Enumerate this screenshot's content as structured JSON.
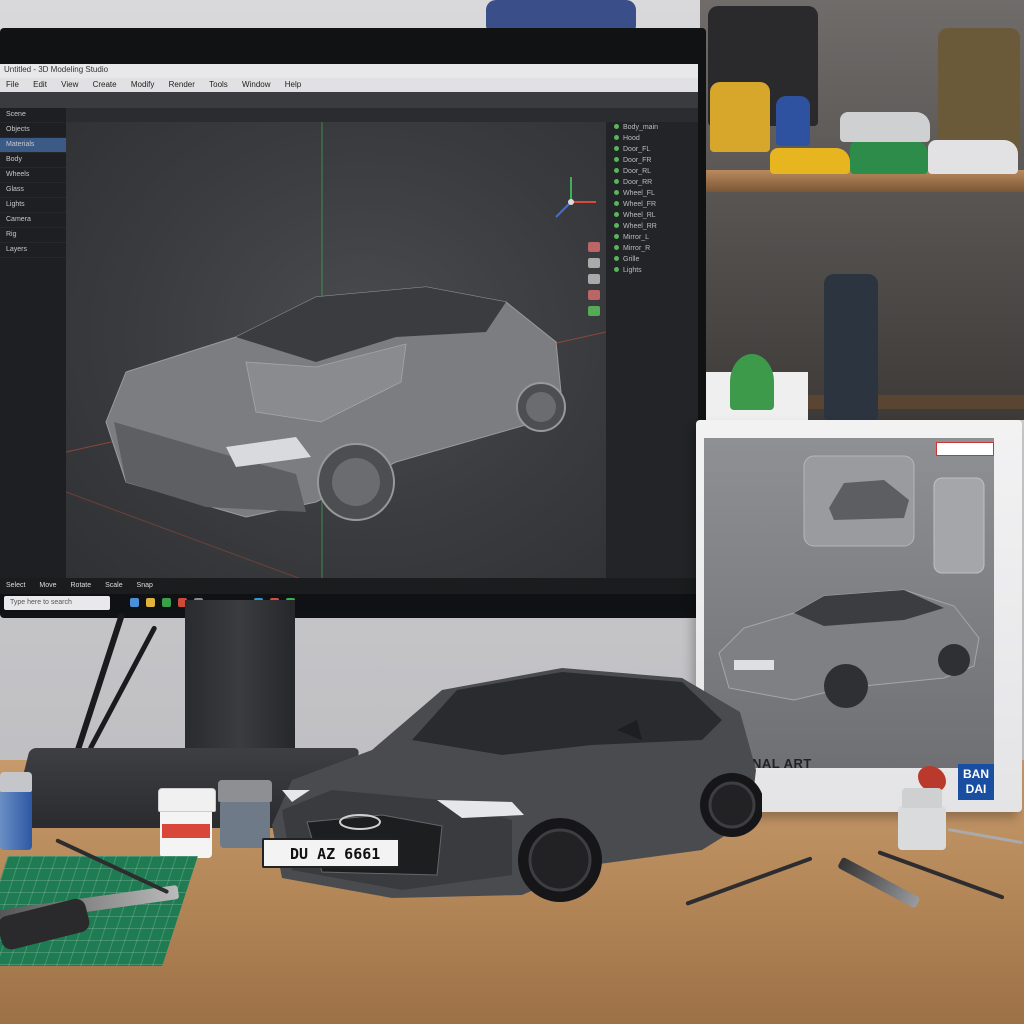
{
  "software": {
    "title_bar_text": "Untitled - 3D Modeling Studio",
    "menu": [
      "File",
      "Edit",
      "View",
      "Create",
      "Modify",
      "Render",
      "Tools",
      "Window",
      "Help"
    ],
    "left_panel_items": [
      "Scene",
      "Objects",
      "Materials",
      "Body",
      "Wheels",
      "Glass",
      "Lights",
      "Camera",
      "Rig",
      "Layers"
    ],
    "right_panel_items": [
      "Body_main",
      "Hood",
      "Door_FL",
      "Door_FR",
      "Door_RL",
      "Door_RR",
      "Wheel_FL",
      "Wheel_FR",
      "Wheel_RL",
      "Wheel_RR",
      "Mirror_L",
      "Mirror_R",
      "Grille",
      "Lights"
    ],
    "timeline_labels": [
      "Select",
      "Move",
      "Rotate",
      "Scale",
      "Snap"
    ],
    "taskbar_search_placeholder": "Type here to search"
  },
  "model_car": {
    "license_plate": "DU AZ 6661"
  },
  "box": {
    "title": "NAL ART",
    "brand": "BAN DAI"
  },
  "colors": {
    "car_body": "#4a4b4f",
    "desk_wood": "#b48758",
    "bandai_blue": "#1a4ea1",
    "mat_green": "#1f7b52"
  }
}
